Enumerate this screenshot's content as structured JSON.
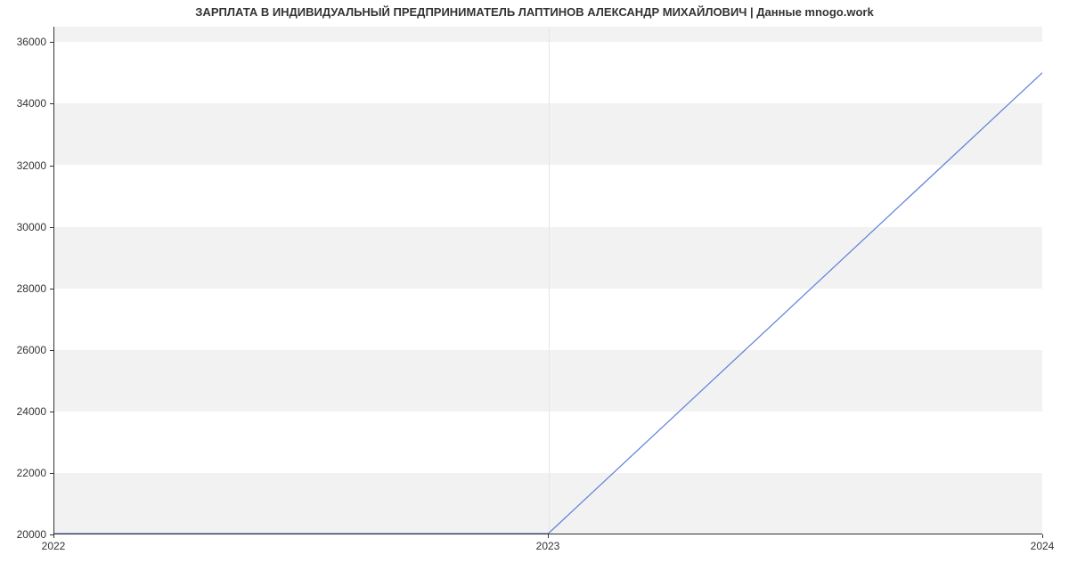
{
  "chart_data": {
    "type": "line",
    "title": "ЗАРПЛАТА В ИНДИВИДУАЛЬНЫЙ ПРЕДПРИНИМАТЕЛЬ ЛАПТИНОВ АЛЕКСАНДР МИХАЙЛОВИЧ | Данные mnogo.work",
    "xlabel": "",
    "ylabel": "",
    "x": [
      2022,
      2023,
      2024
    ],
    "series": [
      {
        "name": "salary",
        "values": [
          20000,
          20000,
          35000
        ]
      }
    ],
    "x_ticks": [
      2022,
      2023,
      2024
    ],
    "y_ticks": [
      20000,
      22000,
      24000,
      26000,
      28000,
      30000,
      32000,
      34000,
      36000
    ],
    "xlim": [
      2022,
      2024
    ],
    "ylim": [
      20000,
      36500
    ],
    "grid": {
      "x": true,
      "y": "bands"
    },
    "line_color": "#5b7fd9"
  }
}
